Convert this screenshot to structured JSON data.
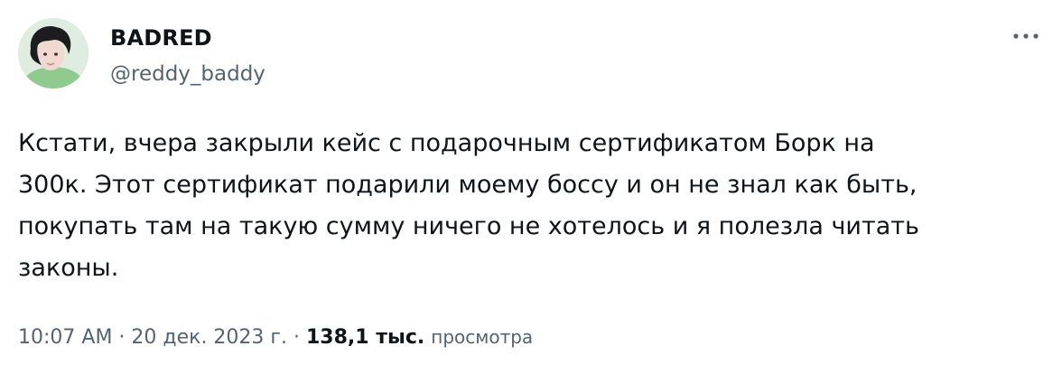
{
  "author": {
    "display_name": "BADRED",
    "handle": "@reddy_baddy"
  },
  "more_icon": "more-horizontal-icon",
  "tweet": {
    "text": "Кстати, вчера закрыли кейс с подарочным сертификатом Борк на\n300к. Этот сертификат подарили моему боссу и он не знал как быть,\nпокупать там на такую сумму ничего не хотелось и я полезла читать\nзаконы."
  },
  "meta": {
    "time": "10:07 AM",
    "separator": " · ",
    "date": "20 дек. 2023 г.",
    "views_count": "138,1 тыс.",
    "views_label": "просмотра"
  },
  "colors": {
    "text": "#0f1419",
    "secondary": "#536471",
    "background": "#ffffff"
  }
}
